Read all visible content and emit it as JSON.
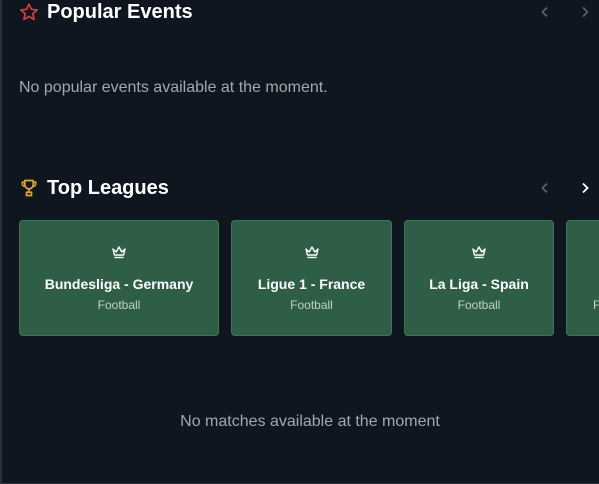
{
  "popular_events": {
    "title": "Popular Events",
    "icon": "star-icon",
    "empty_message": "No popular events available at the moment."
  },
  "top_leagues": {
    "title": "Top Leagues",
    "icon": "trophy-icon",
    "leagues": [
      {
        "name": "Bundesliga - Germany",
        "sport": "Football",
        "icon": "crown-icon"
      },
      {
        "name": "Ligue 1 - France",
        "sport": "Football",
        "icon": "crown-icon"
      },
      {
        "name": "La Liga - Spain",
        "sport": "Football",
        "icon": "crown-icon"
      },
      {
        "name": "",
        "sport": "F",
        "icon": "crown-icon"
      }
    ]
  },
  "matches": {
    "empty_message": "No matches available at the moment"
  },
  "colors": {
    "background": "#0f161f",
    "card": "#2e5e46",
    "star": "#e53935",
    "trophy": "#e0a526",
    "muted_text": "#a3a8ae"
  }
}
